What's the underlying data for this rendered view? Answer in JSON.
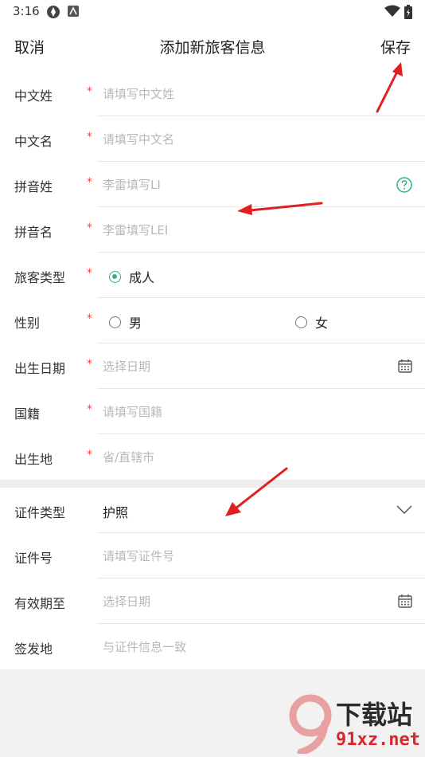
{
  "status_bar": {
    "time": "3:16"
  },
  "header": {
    "cancel_label": "取消",
    "title": "添加新旅客信息",
    "save_label": "保存"
  },
  "required_mark": "*",
  "personal": [
    {
      "label": "中文姓",
      "placeholder": "请填写中文姓"
    },
    {
      "label": "中文名",
      "placeholder": "请填写中文名"
    },
    {
      "label": "拼音姓",
      "placeholder": "李雷填写LI"
    },
    {
      "label": "拼音名",
      "placeholder": "李雷填写LEI"
    }
  ],
  "traveler_type": {
    "label": "旅客类型",
    "option": "成人",
    "selected": true
  },
  "gender": {
    "label": "性别",
    "options": [
      "男",
      "女"
    ],
    "selected": null
  },
  "birth_date": {
    "label": "出生日期",
    "placeholder": "选择日期"
  },
  "nationality": {
    "label": "国籍",
    "placeholder": "请填写国籍"
  },
  "birthplace": {
    "label": "出生地",
    "placeholder": "省/直辖市"
  },
  "id_type": {
    "label": "证件类型",
    "value": "护照"
  },
  "id_number": {
    "label": "证件号",
    "placeholder": "请填写证件号"
  },
  "valid_until": {
    "label": "有效期至",
    "placeholder": "选择日期"
  },
  "issue_place": {
    "label": "签发地",
    "placeholder": "与证件信息一致"
  },
  "watermark": {
    "brand": "下载站",
    "domain": "91xz.net",
    "logo": "9"
  },
  "colors": {
    "accent": "#2bb28a",
    "required": "#f04a4a",
    "annotation": "#e02020"
  }
}
